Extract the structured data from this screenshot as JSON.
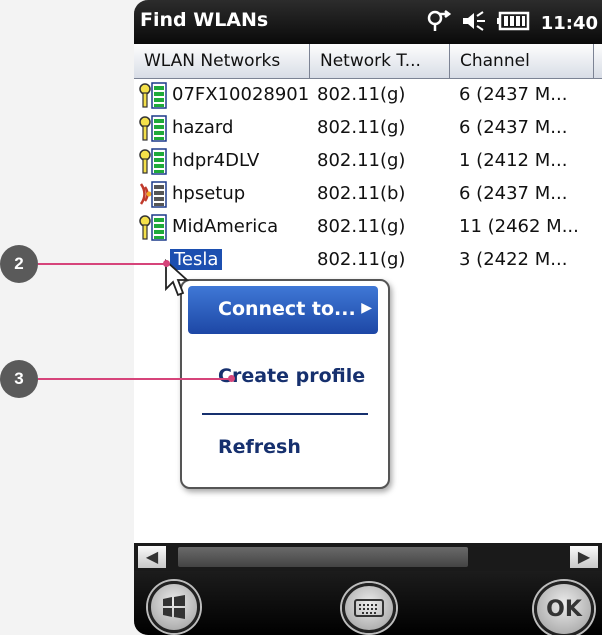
{
  "window": {
    "title": "Find WLANs",
    "clock": "11:40"
  },
  "status_icons": [
    "connectivity-icon",
    "speaker-muted-icon",
    "battery-icon"
  ],
  "columns": [
    "WLAN Networks",
    "Network T...",
    "Channel"
  ],
  "networks": [
    {
      "name": "07FX10028901",
      "type": "802.11(g)",
      "channel": "6 (2437 M...",
      "icon": "wifi-secured-icon"
    },
    {
      "name": "hazard",
      "type": "802.11(g)",
      "channel": "6 (2437 M...",
      "icon": "wifi-secured-icon"
    },
    {
      "name": "hdpr4DLV",
      "type": "802.11(g)",
      "channel": "1 (2412 M...",
      "icon": "wifi-secured-icon"
    },
    {
      "name": "hpsetup",
      "type": "802.11(b)",
      "channel": "6 (2437 M...",
      "icon": "wifi-adhoc-icon"
    },
    {
      "name": "MidAmerica",
      "type": "802.11(g)",
      "channel": "11 (2462 M...",
      "icon": "wifi-secured-icon"
    },
    {
      "name": "Tesla",
      "type": "802.11(g)",
      "channel": "3 (2422 M...",
      "icon": "wifi-secured-icon",
      "selected": true
    }
  ],
  "context_menu": {
    "connect": "Connect to...",
    "create_profile": "Create profile",
    "refresh": "Refresh"
  },
  "bottom_bar": {
    "ok": "OK"
  },
  "callouts": [
    "2",
    "3"
  ],
  "accent": "#1c4fb0",
  "callout_line_color": "#d6447a"
}
